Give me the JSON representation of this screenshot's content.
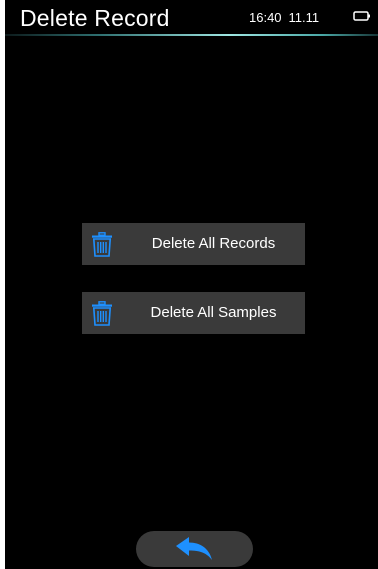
{
  "header": {
    "title": "Delete Record",
    "time": "16:40",
    "date": "11.11",
    "battery_icon": "battery-icon"
  },
  "menu": {
    "items": [
      {
        "label": "Delete All Records",
        "icon": "trash-icon"
      },
      {
        "label": "Delete All Samples",
        "icon": "trash-icon"
      }
    ]
  },
  "footer": {
    "back_icon": "back-arrow-icon"
  },
  "colors": {
    "background": "#000000",
    "button": "#3a3a3a",
    "accent": "#1e90ff",
    "text": "#ffffff",
    "divider": "#9fe6e2"
  }
}
